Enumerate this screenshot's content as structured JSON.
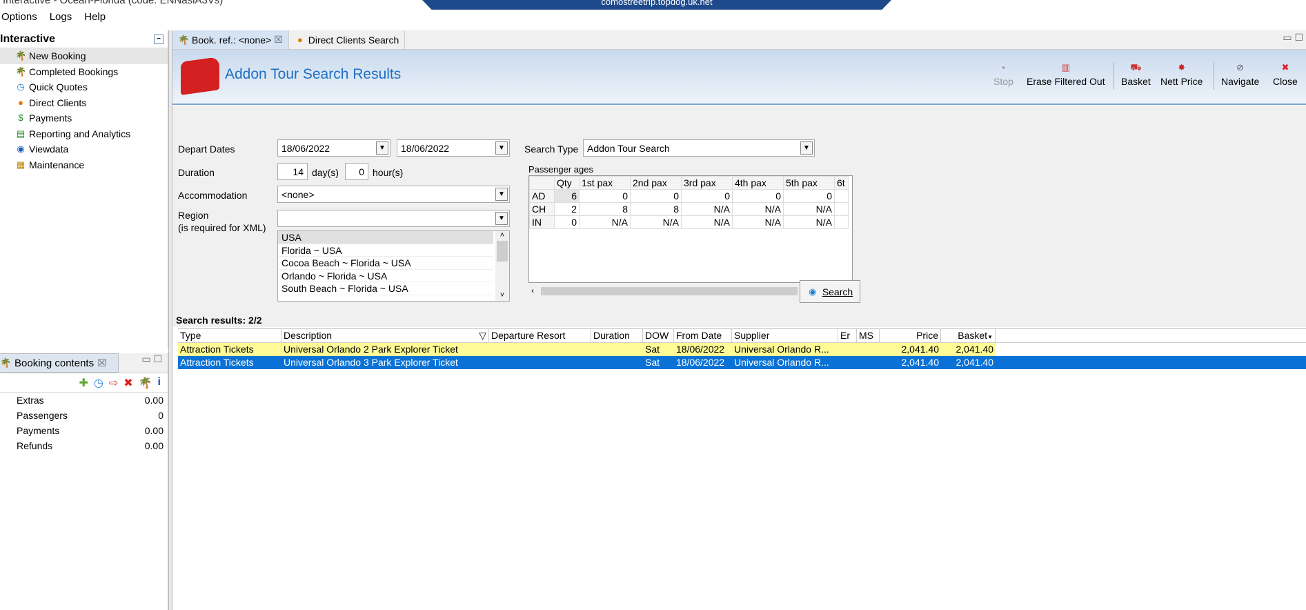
{
  "window": {
    "title": "Interactive - Ocean-Florida (code: ENNasiA3Vs)",
    "remote_host": "comostreetrip.topdog.uk.net"
  },
  "menu": [
    "Options",
    "Logs",
    "Help"
  ],
  "sidebar": {
    "title": "Interactive",
    "items": [
      {
        "label": "New Booking",
        "icon": "palm-tree-icon"
      },
      {
        "label": "Completed Bookings",
        "icon": "palm-tree-icon"
      },
      {
        "label": "Quick Quotes",
        "icon": "clock-icon"
      },
      {
        "label": "Direct Clients",
        "icon": "person-icon"
      },
      {
        "label": "Payments",
        "icon": "money-icon"
      },
      {
        "label": "Reporting and Analytics",
        "icon": "report-icon"
      },
      {
        "label": "Viewdata",
        "icon": "globe-icon"
      },
      {
        "label": "Maintenance",
        "icon": "toolbox-icon"
      }
    ]
  },
  "booking_contents": {
    "tab": "Booking contents",
    "rows": [
      {
        "label": "Extras",
        "value": "0.00"
      },
      {
        "label": "Passengers",
        "value": "0"
      },
      {
        "label": "Payments",
        "value": "0.00"
      },
      {
        "label": "Refunds",
        "value": "0.00"
      }
    ]
  },
  "tabs": [
    {
      "label": "Book. ref.: <none>"
    },
    {
      "label": "Direct Clients Search"
    }
  ],
  "header": {
    "title": "Addon Tour Search Results"
  },
  "toolbar": {
    "stop": "Stop",
    "erase": "Erase Filtered Out",
    "basket": "Basket",
    "nett": "Nett Price",
    "navigate": "Navigate",
    "close": "Close"
  },
  "form": {
    "depart_label": "Depart Dates",
    "depart_from": "18/06/2022",
    "depart_to": "18/06/2022",
    "search_type_label": "Search Type",
    "search_type": "Addon Tour Search",
    "duration_label": "Duration",
    "days": "14",
    "days_unit": "day(s)",
    "hours": "0",
    "hours_unit": "hour(s)",
    "accommodation_label": "Accommodation",
    "accommodation": "<none>",
    "region_label": "Region",
    "region_note": "(is required for XML)",
    "region_value": "",
    "region_options": [
      "USA",
      "Florida ~ USA",
      "Cocoa Beach ~ Florida ~ USA",
      "Orlando ~ Florida ~ USA",
      "South Beach ~ Florida ~ USA"
    ],
    "search_button": "Search"
  },
  "passengers": {
    "title": "Passenger ages",
    "headers": [
      "",
      "Qty",
      "1st pax",
      "2nd pax",
      "3rd pax",
      "4th pax",
      "5th pax",
      "6t"
    ],
    "rows": [
      [
        "AD",
        "6",
        "0",
        "0",
        "0",
        "0",
        "0"
      ],
      [
        "CH",
        "2",
        "8",
        "8",
        "N/A",
        "N/A",
        "N/A"
      ],
      [
        "IN",
        "0",
        "N/A",
        "N/A",
        "N/A",
        "N/A",
        "N/A"
      ]
    ]
  },
  "results": {
    "label": "Search results: 2/2",
    "columns": [
      "Type",
      "Description",
      "Departure Resort",
      "Duration",
      "DOW",
      "From Date",
      "Supplier",
      "Er",
      "MS",
      "Price",
      "Basket"
    ],
    "rows": [
      [
        "Attraction Tickets",
        "Universal Orlando 2 Park Explorer Ticket",
        "",
        "",
        "Sat",
        "18/06/2022",
        "Universal Orlando R...",
        "",
        "",
        "2,041.40",
        "2,041.40"
      ],
      [
        "Attraction Tickets",
        "Universal Orlando 3 Park Explorer Ticket",
        "",
        "",
        "Sat",
        "18/06/2022",
        "Universal Orlando R...",
        "",
        "",
        "2,041.40",
        "2,041.40"
      ]
    ]
  }
}
